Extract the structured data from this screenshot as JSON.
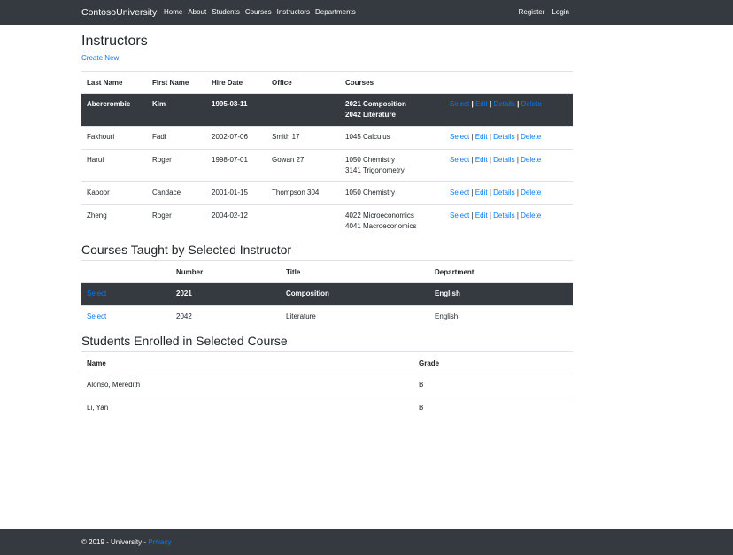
{
  "navbar": {
    "brand": "ContosoUniversity",
    "links": [
      "Home",
      "About",
      "Students",
      "Courses",
      "Instructors",
      "Departments"
    ],
    "right_links": [
      "Register",
      "Login"
    ]
  },
  "page": {
    "title": "Instructors",
    "create_new": "Create New"
  },
  "instructors_table": {
    "headers": [
      "Last Name",
      "First Name",
      "Hire Date",
      "Office",
      "Courses"
    ],
    "actions": [
      "Select",
      "Edit",
      "Details",
      "Delete"
    ],
    "separator": "|",
    "rows": [
      {
        "last": "Abercrombie",
        "first": "Kim",
        "hire": "1995-03-11",
        "office": "",
        "courses": [
          "2021 Composition",
          "2042 Literature"
        ]
      },
      {
        "last": "Fakhouri",
        "first": "Fadi",
        "hire": "2002-07-06",
        "office": "Smith 17",
        "courses": [
          "1045 Calculus"
        ]
      },
      {
        "last": "Harui",
        "first": "Roger",
        "hire": "1998-07-01",
        "office": "Gowan 27",
        "courses": [
          "1050 Chemistry",
          "3141 Trigonometry"
        ]
      },
      {
        "last": "Kapoor",
        "first": "Candace",
        "hire": "2001-01-15",
        "office": "Thompson 304",
        "courses": [
          "1050 Chemistry"
        ]
      },
      {
        "last": "Zheng",
        "first": "Roger",
        "hire": "2004-02-12",
        "office": "",
        "courses": [
          "4022 Microeconomics",
          "4041 Macroeconomics"
        ]
      }
    ]
  },
  "courses_section": {
    "title": "Courses Taught by Selected Instructor",
    "headers": [
      "",
      "Number",
      "Title",
      "Department"
    ],
    "rows": [
      {
        "action": "Select",
        "number": "2021",
        "title": "Composition",
        "department": "English"
      },
      {
        "action": "Select",
        "number": "2042",
        "title": "Literature",
        "department": "English"
      }
    ]
  },
  "students_section": {
    "title": "Students Enrolled in Selected Course",
    "headers": [
      "Name",
      "Grade"
    ],
    "rows": [
      {
        "name": "Alonso, Meredith",
        "grade": "B"
      },
      {
        "name": "Li, Yan",
        "grade": "B"
      }
    ]
  },
  "footer": {
    "text": "© 2019 - University - ",
    "privacy": "Privacy"
  },
  "colors": {
    "navbar_bg": "#343a40",
    "link": "#007bff",
    "selected_row_bg": "#343a40"
  }
}
